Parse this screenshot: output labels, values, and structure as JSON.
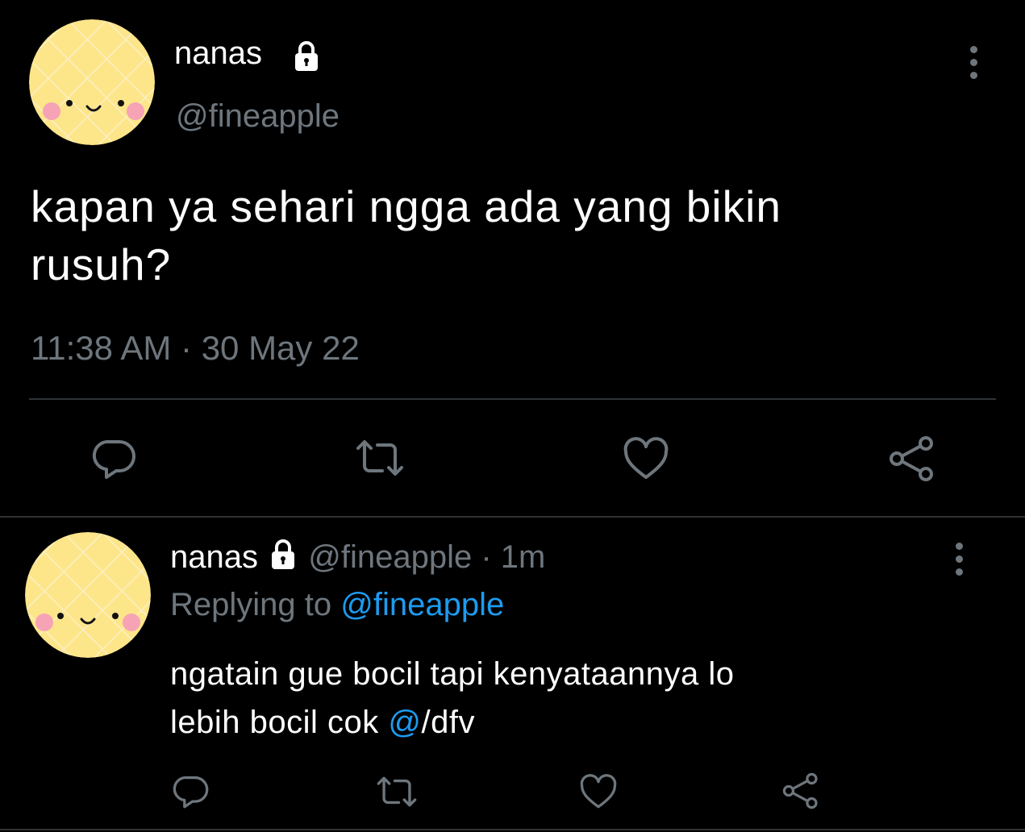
{
  "main_tweet": {
    "author_name": "nanas",
    "handle": "@fineapple",
    "text_line1": "kapan ya sehari ngga ada yang bikin",
    "text_line2": "rusuh?",
    "time": "11:38 AM",
    "separator": "·",
    "date": "30 May 22",
    "actions": [
      "reply-icon",
      "retweet-icon",
      "like-icon",
      "share-icon"
    ]
  },
  "reply_tweet": {
    "author_name": "nanas",
    "handle": "@fineapple",
    "separator": "·",
    "age": "1m",
    "replying_to_label": "Replying to",
    "replying_to_handle": "@fineapple",
    "text_line1": "ngatain gue bocil tapi kenyataannya lo",
    "text_line2_plain": "lebih bocil cok ",
    "text_line2_link": "@",
    "text_line2_tail": "/dfv",
    "actions": [
      "reply-icon",
      "retweet-icon",
      "like-icon",
      "share-icon"
    ]
  },
  "colors": {
    "background": "#000000",
    "muted": "#6e767d",
    "link": "#1d9bf0",
    "avatar_yellow": "#fde58a",
    "avatar_cheek": "#f6a3b6"
  }
}
